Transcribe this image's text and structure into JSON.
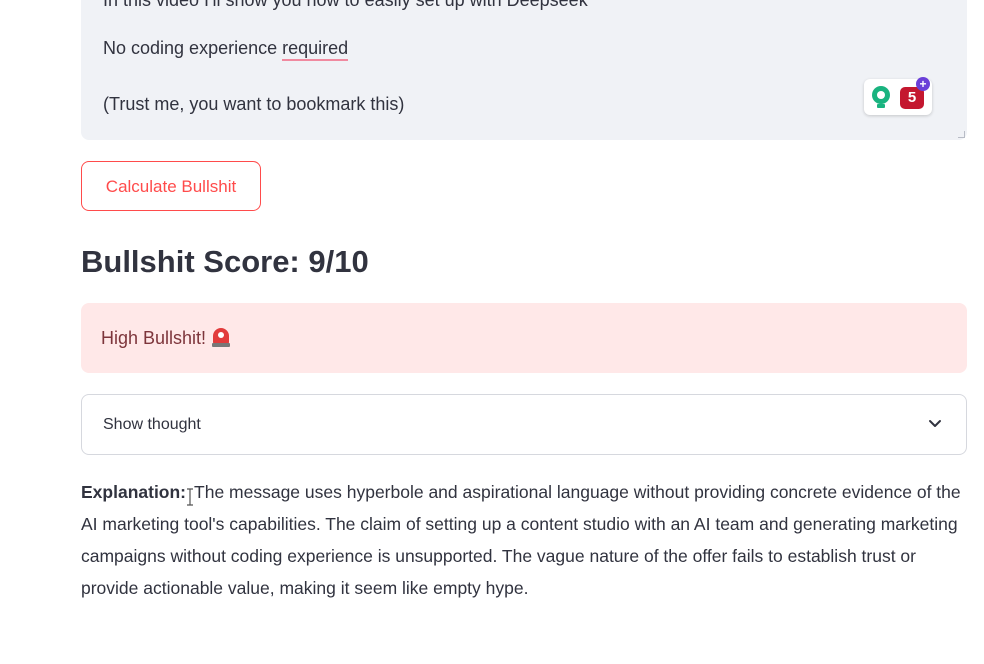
{
  "message_box": {
    "line_partial": "In this video I'll show you how to easily set up with Deepseek",
    "line_required_prefix": "No coding experience ",
    "line_required_word": "required",
    "line_bookmark": "(Trust me, you want to bookmark this)"
  },
  "extension_badge": {
    "count": "5",
    "plus": "+",
    "colors": {
      "bulb": "#19b37f",
      "count_bg": "#c4172f",
      "plus_bg": "#6a3fd8"
    }
  },
  "calculate_button": {
    "label": "Calculate Bullshit"
  },
  "score": {
    "heading": "Bullshit Score: 9/10"
  },
  "alert": {
    "text": "High Bullshit!",
    "icon": "siren-icon"
  },
  "expander": {
    "label": "Show thought",
    "icon": "chevron-down-icon"
  },
  "explanation": {
    "label": "Explanation:",
    "text": "The message uses hyperbole and aspirational language without providing concrete evidence of the AI marketing tool's capabilities. The claim of setting up a content studio with an AI team and generating marketing campaigns without coding experience is unsupported. The vague nature of the offer fails to establish trust or provide actionable value, making it seem like empty hype."
  },
  "colors": {
    "accent": "#ff4b4b",
    "alert_bg": "#ffe8e8",
    "alert_text": "#7d353b",
    "textarea_bg": "#f0f2f6",
    "text": "#31333f"
  }
}
